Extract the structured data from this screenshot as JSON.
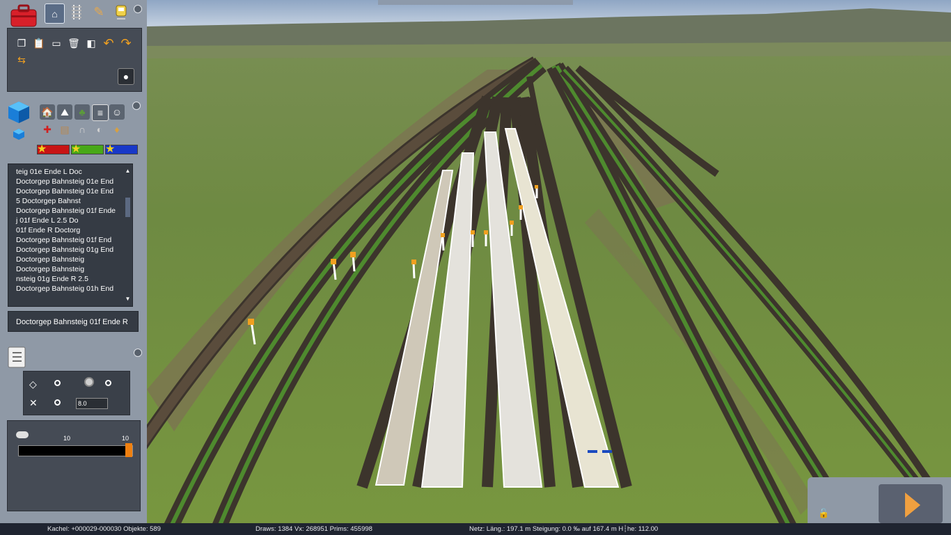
{
  "toolbar": {
    "icons": [
      "toolbox-icon",
      "home-icon",
      "track-icon",
      "brush-icon",
      "train-icon"
    ]
  },
  "edit_tools": [
    "copy-icon",
    "paste-icon",
    "screen-icon",
    "delete-icon",
    "camera-icon",
    "undo-icon",
    "redo-icon",
    "flip-icon",
    "smoke-icon"
  ],
  "objects": {
    "categories": [
      "house-icon",
      "landscape-icon",
      "tree-icon",
      "rail-icon",
      "person-icon",
      "signal-icon",
      "sleeper-icon",
      "tunnel-icon",
      "lamp-icon",
      "goods-icon"
    ],
    "colors": {
      "red": "#c81414",
      "green": "#48a818",
      "blue": "#1838c8",
      "star": "#f0d020"
    }
  },
  "list": {
    "items": [
      "teig 01e Ende L              Doc",
      "Doctorgep Bahnsteig 01e End",
      "Doctorgep Bahnsteig 01e End",
      "5            Doctorgep Bahnst",
      "Doctorgep Bahnsteig 01f Ende",
      "j 01f Ende L 2.5                Do",
      "01f Ende R               Doctorg",
      "Doctorgep Bahnsteig 01f End",
      "Doctorgep Bahnsteig 01g End",
      "         Doctorgep Bahnsteig",
      "              Doctorgep Bahnsteig",
      "nsteig 01g Ende R 2.5",
      "Doctorgep Bahnsteig 01h End"
    ],
    "selected": "Doctorgep Bahnsteig 01f Ende R",
    "scroll_up": "▲",
    "scroll_down": "▼"
  },
  "height_tool": {
    "value": "8.0",
    "slider_min_label": "10",
    "slider_max_label": "10"
  },
  "status": {
    "kachel": "Kachel: +000029-000030  Objekte: 589",
    "draws": "Draws: 1384 Vx: 268951 Prims: 455998",
    "netz": "Netz:  Läng.:  197.1 m Steigung:  0.0 ‰ auf 167.4 m H┆he: 112.00"
  }
}
